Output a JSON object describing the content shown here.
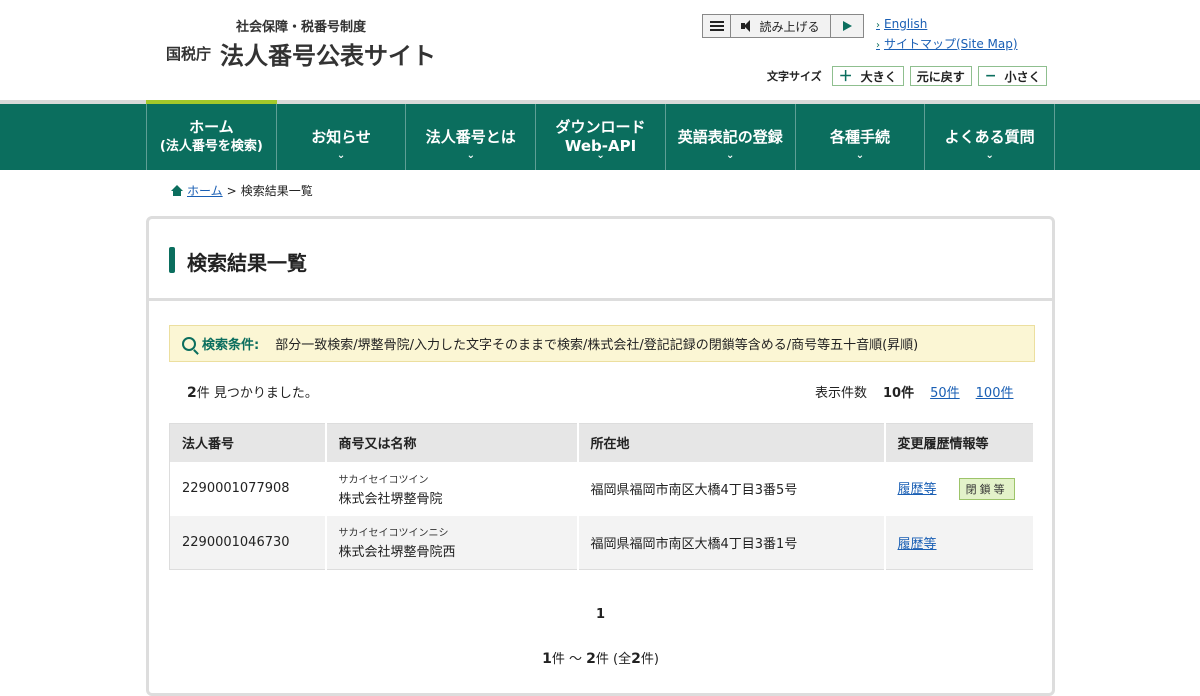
{
  "header": {
    "logo_sub": "社会保障・税番号制度",
    "logo_agency": "国税庁",
    "logo_main": "法人番号公表サイト",
    "read_aloud_label": "読み上げる",
    "links": [
      "English",
      "サイトマップ(Site Map)"
    ],
    "font_size_label": "文字サイズ",
    "font_buttons": [
      {
        "symbol": "＋",
        "label": "大きく"
      },
      {
        "symbol": "",
        "label": "元に戻す"
      },
      {
        "symbol": "−",
        "label": "小さく"
      }
    ]
  },
  "nav": {
    "items": [
      {
        "line1": "ホーム",
        "line2": "(法人番号を検索)",
        "arrow": ""
      },
      {
        "line1": "お知らせ",
        "line2": "",
        "arrow": "⌄"
      },
      {
        "line1": "法人番号とは",
        "line2": "",
        "arrow": "⌄"
      },
      {
        "line1": "ダウンロード",
        "line2": "Web-API",
        "arrow": "⌄"
      },
      {
        "line1": "英語表記の登録",
        "line2": "",
        "arrow": "⌄"
      },
      {
        "line1": "各種手続",
        "line2": "",
        "arrow": "⌄"
      },
      {
        "line1": "よくある質問",
        "line2": "",
        "arrow": "⌄"
      }
    ]
  },
  "breadcrumb": {
    "home": "ホーム",
    "separator": ">",
    "current": "検索結果一覧"
  },
  "panel": {
    "title": "検索結果一覧",
    "condition_label": "検索条件:",
    "condition_text": "部分一致検索/堺整骨院/入力した文字そのままで検索/株式会社/登記記録の閉鎖等含める/商号等五十音順(昇順)",
    "count_num": "2",
    "count_unit": "件",
    "count_suffix": " 見つかりました。",
    "perpage_label": "表示件数",
    "perpage_current": "10件",
    "perpage_options": [
      "50件",
      "100件"
    ]
  },
  "table": {
    "headers": [
      "法人番号",
      "商号又は名称",
      "所在地",
      "変更履歴情報等"
    ],
    "rows": [
      {
        "number": "2290001077908",
        "kana": "サカイセイコツイン",
        "name": "株式会社堺整骨院",
        "address": "福岡県福岡市南区大橋4丁目3番5号",
        "history": "履歴等",
        "badge": "閉鎖等"
      },
      {
        "number": "2290001046730",
        "kana": "サカイセイコツインニシ",
        "name": "株式会社堺整骨院西",
        "address": "福岡県福岡市南区大橋4丁目3番1号",
        "history": "履歴等",
        "badge": ""
      }
    ]
  },
  "pager": {
    "current_page": "1",
    "range_start": "1",
    "range_sep": "件 〜 ",
    "range_end": "2",
    "range_total_prefix": "件 (全",
    "range_total": "2",
    "range_total_suffix": "件)"
  },
  "colors": {
    "brand": "#0b6e5e",
    "accent": "#a3c82a",
    "link": "#1a5fb4",
    "condition_bg": "#fbf6d4"
  }
}
